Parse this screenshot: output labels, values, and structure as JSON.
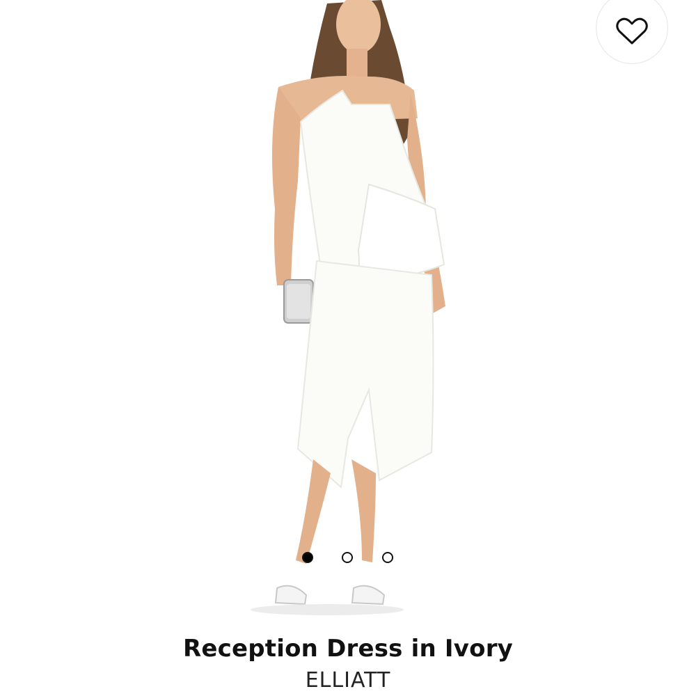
{
  "product": {
    "title": "Reception Dress in Ivory",
    "brand": "ELLIATT",
    "image_alt": "Model wearing a strapless ivory ruffle midi dress with silver clutch and strappy sandals"
  },
  "favorite": {
    "icon": "heart-outline-icon",
    "active": false
  },
  "carousel": {
    "count": 3,
    "active_index": 0
  },
  "colors": {
    "background": "#ffffff",
    "dress": "#fbfbf8",
    "skin": "#e6b894",
    "hair": "#6b4a32",
    "text": "#111111"
  }
}
